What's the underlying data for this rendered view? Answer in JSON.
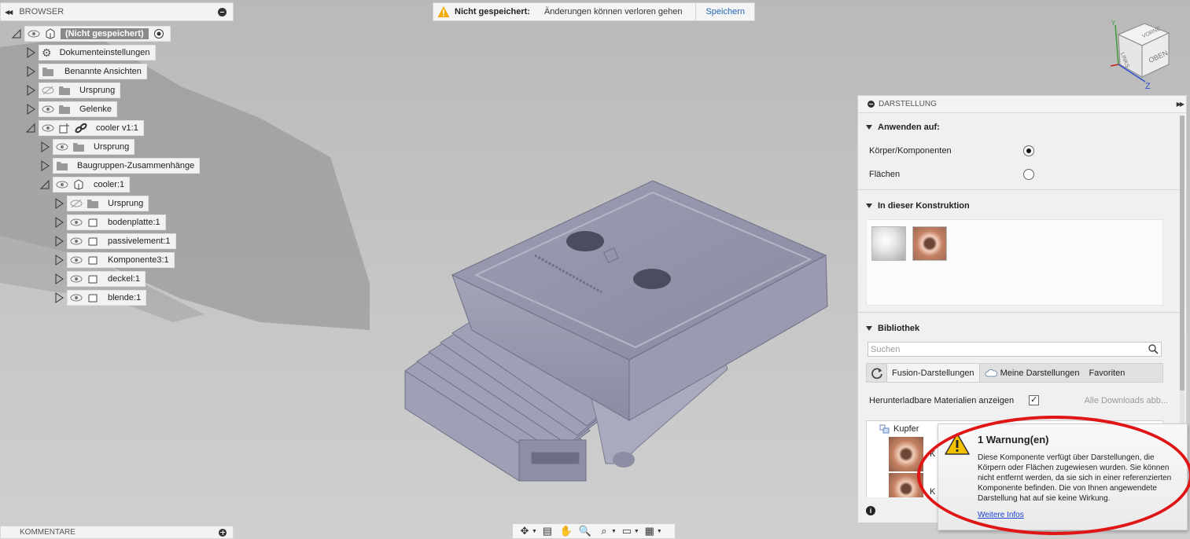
{
  "banner": {
    "title": "Nicht gespeichert:",
    "message": "Änderungen können verloren gehen",
    "save_label": "Speichern"
  },
  "browser": {
    "title": "BROWSER",
    "root_label": "(Nicht gespeichert)",
    "nodes": [
      {
        "label": "Dokumenteinstellungen"
      },
      {
        "label": "Benannte Ansichten"
      },
      {
        "label": "Ursprung"
      },
      {
        "label": "Gelenke"
      },
      {
        "label": "cooler v1:1"
      },
      {
        "label": "Ursprung"
      },
      {
        "label": "Baugruppen-Zusammenhänge"
      },
      {
        "label": "cooler:1"
      },
      {
        "label": "Ursprung"
      },
      {
        "label": "bodenplatte:1"
      },
      {
        "label": "passivelement:1"
      },
      {
        "label": "Komponente3:1"
      },
      {
        "label": "deckel:1"
      },
      {
        "label": "blende:1"
      }
    ]
  },
  "comments": {
    "title": "KOMMENTARE"
  },
  "viewcube": {
    "face_top": "OBEN",
    "face_front": "VORNE",
    "face_side": "LINKS",
    "axis_z": "Z",
    "axis_y": "Y"
  },
  "panel": {
    "title": "DARSTELLUNG",
    "apply_to": {
      "title": "Anwenden auf:",
      "option_body": "Körper/Komponenten",
      "option_faces": "Flächen",
      "selected": "Körper/Komponenten"
    },
    "in_design": {
      "title": "In dieser Konstruktion"
    },
    "library": {
      "title": "Bibliothek",
      "search_placeholder": "Suchen",
      "tab_fusion": "Fusion-Darstellungen",
      "tab_mine": "Meine Darstellungen",
      "tab_favorites": "Favoriten",
      "downloadable_label": "Herunterladbare Materialien anzeigen",
      "downloadable_checked": true,
      "all_downloads": "Alle Downloads abb...",
      "folder": "Kupfer",
      "item_prefix": "K"
    },
    "info_label": "i"
  },
  "warning": {
    "title": "1 Warnung(en)",
    "text": "Diese Komponente verfügt über Darstellungen, die Körpern oder Flächen zugewiesen wurden. Sie können nicht entfernt werden, da sie sich in einer referenzierten Komponente befinden. Die von Ihnen angewendete Darstellung hat auf sie keine Wirkung.",
    "link": "Weitere Infos"
  },
  "colors": {
    "model": "#8e8fa6",
    "annotation_ring": "#e01616",
    "link": "#1a3fd0"
  }
}
